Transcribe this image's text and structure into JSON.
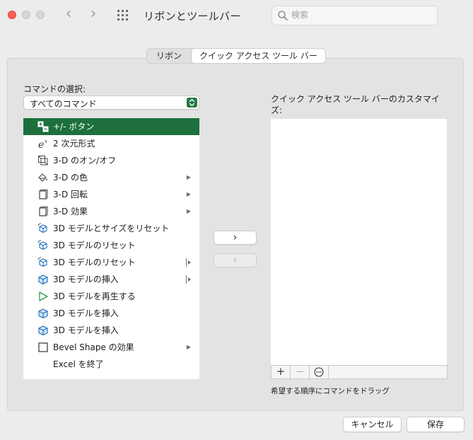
{
  "window": {
    "title": "リボンとツールバー"
  },
  "search": {
    "placeholder": "検索"
  },
  "tabs": [
    {
      "label": "リボン",
      "active": false
    },
    {
      "label": "クイック アクセス ツール バー",
      "active": true
    }
  ],
  "commands": {
    "label": "コマンドの選択:",
    "selected": "すべてのコマンド",
    "items": [
      {
        "label": "+/- ボタン",
        "icon": "plus-minus-icon",
        "selected": true
      },
      {
        "label": "2 次元形式",
        "icon": "ex-format-icon"
      },
      {
        "label": "3-D のオン/オフ",
        "icon": "3d-toggle-icon"
      },
      {
        "label": "3-D の色",
        "icon": "paint-bucket-icon",
        "submenu": "arrow"
      },
      {
        "label": "3-D 回転",
        "icon": "3d-rotate-icon",
        "submenu": "arrow"
      },
      {
        "label": "3-D 効果",
        "icon": "3d-effect-icon",
        "submenu": "arrow"
      },
      {
        "label": "3D モデルとサイズをリセット",
        "icon": "cube-reset-icon"
      },
      {
        "label": "3D モデルのリセット",
        "icon": "cube-reset-icon"
      },
      {
        "label": "3D モデルのリセット",
        "icon": "cube-reset-icon",
        "submenu": "split"
      },
      {
        "label": "3D モデルの挿入",
        "icon": "cube-icon",
        "submenu": "split"
      },
      {
        "label": "3D モデルを再生する",
        "icon": "play-icon"
      },
      {
        "label": "3D モデルを挿入",
        "icon": "cube-icon"
      },
      {
        "label": "3D モデルを挿入",
        "icon": "cube-icon"
      },
      {
        "label": "Bevel Shape の効果",
        "icon": "square-icon",
        "submenu": "arrow"
      },
      {
        "label": "Excel を終了",
        "icon": ""
      }
    ]
  },
  "quick_access": {
    "label": "クイック アクセス ツール バーのカスタマイズ:",
    "hint": "希望する順序にコマンドをドラッグ",
    "toolbar": {
      "add": "+",
      "remove": "−",
      "more": "⋯"
    }
  },
  "buttons": {
    "add": "›",
    "remove": "‹",
    "cancel": "キャンセル",
    "save": "保存"
  },
  "colors": {
    "accent": "#1d6f3c",
    "close": "#fe5f57"
  }
}
